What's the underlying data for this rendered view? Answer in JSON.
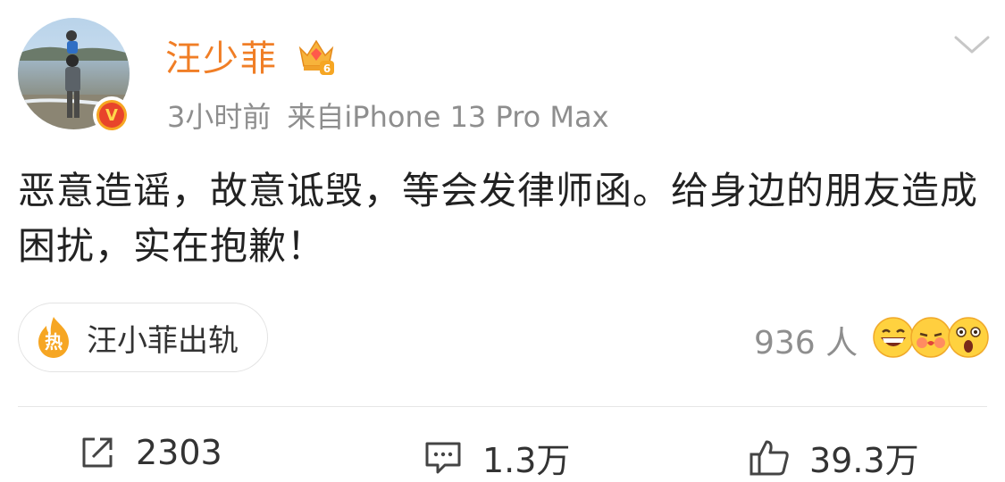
{
  "post": {
    "username": "汪少菲",
    "time": "3小时前",
    "source": "来自iPhone 13 Pro Max",
    "text": "恶意造谣，故意诋毁，等会发律师函。给身边的朋友造成困扰，实在抱歉！",
    "vip_level": "6",
    "verified_mark": "V"
  },
  "hot_topic": {
    "badge": "热",
    "label": "汪小菲出轨"
  },
  "reactions": {
    "count_text": "936 人",
    "emojis": [
      "grin-emoji",
      "kiss-emoji",
      "surprised-emoji"
    ]
  },
  "actions": {
    "repost_count": "2303",
    "comment_count": "1.3万",
    "like_count": "39.3万"
  },
  "colors": {
    "username": "#f07e26",
    "meta": "#8e8e8e",
    "hot": "#f6a623"
  }
}
